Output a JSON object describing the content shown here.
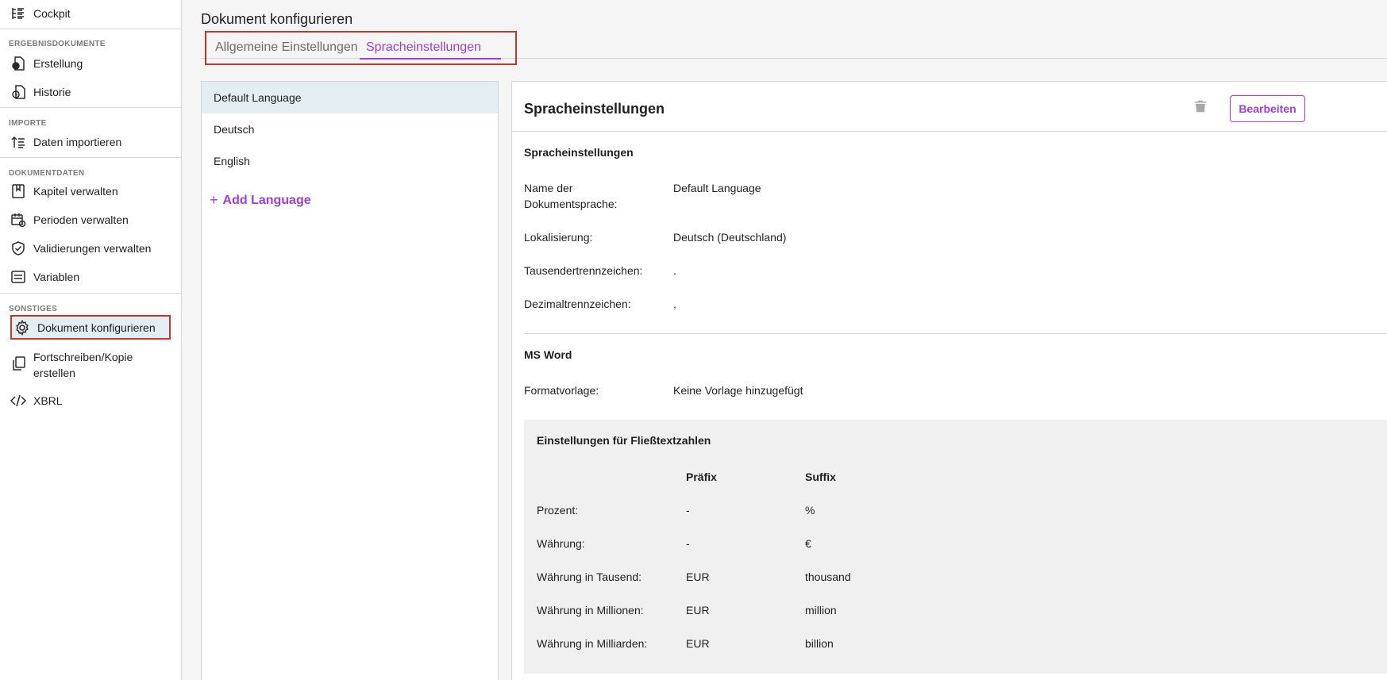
{
  "sidebar": {
    "cockpit": "Cockpit",
    "sections": {
      "ergebnis": "ERGEBNISDOKUMENTE",
      "importe": "IMPORTE",
      "dokumentdaten": "DOKUMENTDATEN",
      "sonstiges": "SONSTIGES"
    },
    "items": {
      "erstellung": "Erstellung",
      "historie": "Historie",
      "daten_importieren": "Daten importieren",
      "kapitel": "Kapitel verwalten",
      "perioden": "Perioden verwalten",
      "validierungen": "Validierungen verwalten",
      "variablen": "Variablen",
      "dokument_konfigurieren": "Dokument konfigurieren",
      "fortschreiben_1": "Fortschreiben/Kopie",
      "fortschreiben_2": "erstellen",
      "xbrl": "XBRL"
    }
  },
  "main": {
    "title": "Dokument konfigurieren",
    "tabs": {
      "general": "Allgemeine Einstellungen",
      "language": "Spracheinstellungen"
    }
  },
  "languages": {
    "items": [
      "Default Language",
      "Deutsch",
      "English"
    ],
    "add_label": "Add Language"
  },
  "detail": {
    "title": "Spracheinstellungen",
    "edit_label": "Bearbeiten",
    "section_language": "Spracheinstellungen",
    "fields": {
      "name_label_1": "Name der",
      "name_label_2": "Dokumentsprache:",
      "name_value": "Default Language",
      "locale_label": "Lokalisierung:",
      "locale_value": "Deutsch (Deutschland)",
      "thousands_label": "Tausendertrennzeichen:",
      "thousands_value": ".",
      "decimal_label": "Dezimaltrennzeichen:",
      "decimal_value": ","
    },
    "section_word": "MS Word",
    "template_label": "Formatvorlage:",
    "template_value": "Keine Vorlage hinzugefügt",
    "number_settings": {
      "heading": "Einstellungen für Fließtextzahlen",
      "col_prefix": "Präfix",
      "col_suffix": "Suffix",
      "rows": [
        {
          "label": "Prozent:",
          "prefix": "-",
          "suffix": "%"
        },
        {
          "label": "Währung:",
          "prefix": "-",
          "suffix": "€"
        },
        {
          "label": "Währung in Tausend:",
          "prefix": "EUR",
          "suffix": "thousand"
        },
        {
          "label": "Währung in Millionen:",
          "prefix": "EUR",
          "suffix": "million"
        },
        {
          "label": "Währung in Milliarden:",
          "prefix": "EUR",
          "suffix": "billion"
        }
      ]
    }
  },
  "colors": {
    "accent": "#9b3fd6",
    "highlight_border": "#c0392b",
    "selected_bg": "#e3eef2"
  }
}
